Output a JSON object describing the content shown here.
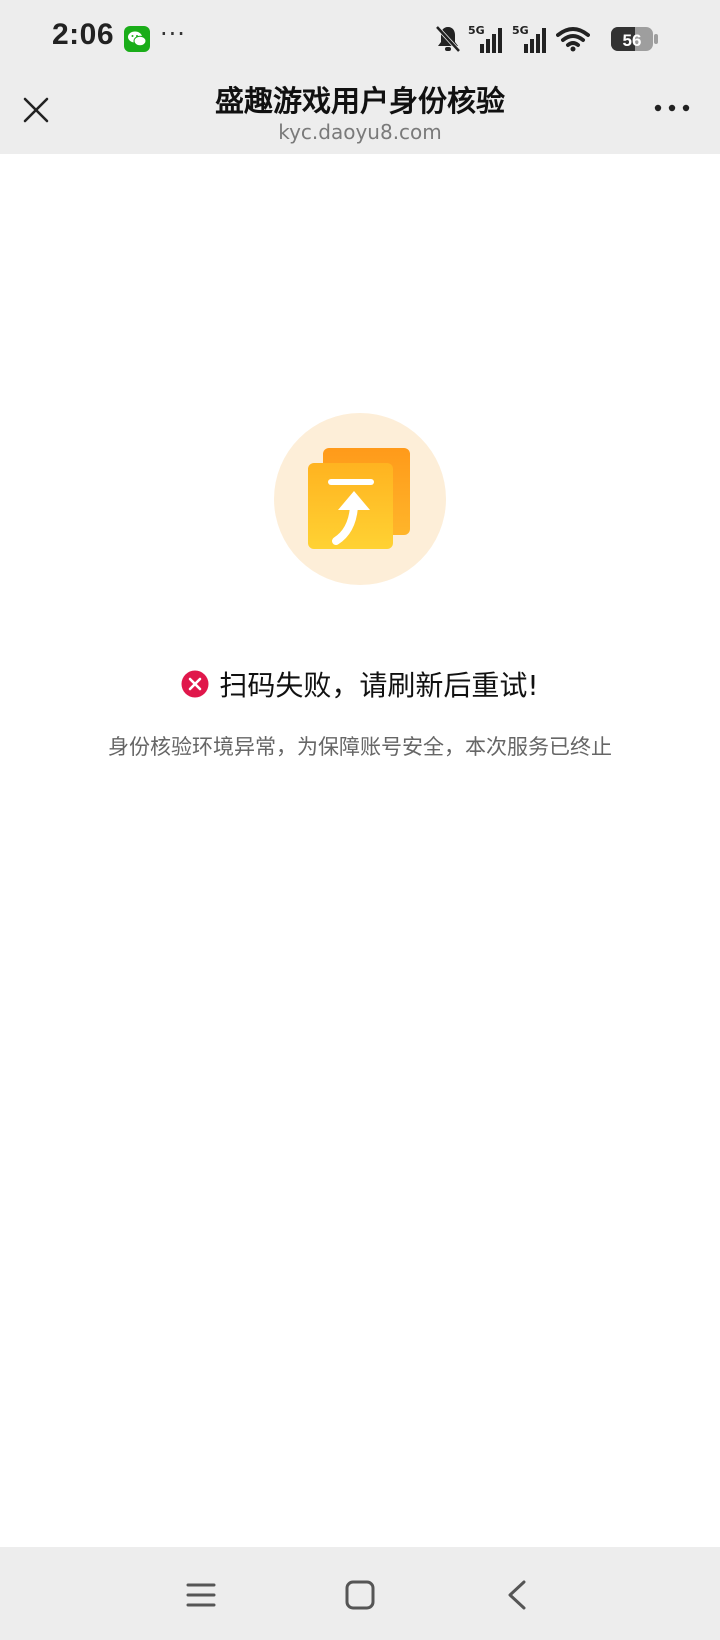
{
  "status_bar": {
    "time": "2:06",
    "app_icon": "wechat-icon",
    "overflow": "···",
    "network_1": "5G",
    "network_2": "5G",
    "battery": "56"
  },
  "nav": {
    "title": "盛趣游戏用户身份核验",
    "domain": "kyc.daoyu8.com",
    "close_icon": "close-icon",
    "menu_icon": "more-icon"
  },
  "main": {
    "illustration_icon": "upload-document-icon",
    "error_icon": "error-circle-icon",
    "error_title": "扫码失败，请刷新后重试!",
    "error_desc": "身份核验环境异常，为保障账号安全，本次服务已终止"
  },
  "system_nav": {
    "menu_icon": "menu-icon",
    "home_icon": "home-icon",
    "back_icon": "back-icon"
  },
  "colors": {
    "bar_bg": "#ededed",
    "accent_orange": "#ffa41b",
    "accent_yellow": "#ffc62a",
    "error_red": "#e0174b",
    "illustration_bg": "#fdeed8"
  }
}
